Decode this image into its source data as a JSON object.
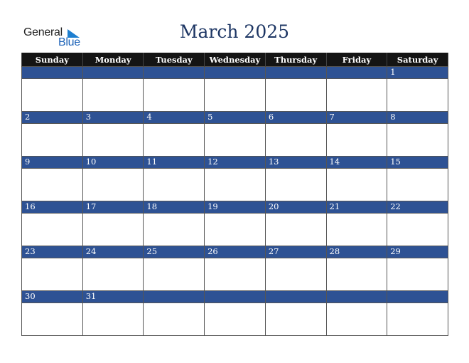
{
  "logo": {
    "line1": "General",
    "line2": "Blue"
  },
  "title": "March 2025",
  "weekdays": [
    "Sunday",
    "Monday",
    "Tuesday",
    "Wednesday",
    "Thursday",
    "Friday",
    "Saturday"
  ],
  "weeks": [
    [
      "",
      "",
      "",
      "",
      "",
      "",
      "1"
    ],
    [
      "2",
      "3",
      "4",
      "5",
      "6",
      "7",
      "8"
    ],
    [
      "9",
      "10",
      "11",
      "12",
      "13",
      "14",
      "15"
    ],
    [
      "16",
      "17",
      "18",
      "19",
      "20",
      "21",
      "22"
    ],
    [
      "23",
      "24",
      "25",
      "26",
      "27",
      "28",
      "29"
    ],
    [
      "30",
      "31",
      "",
      "",
      "",
      "",
      ""
    ]
  ],
  "colors": {
    "header_bg": "#141414",
    "date_bar": "#2e5294",
    "title": "#1c3563",
    "logo_blue": "#1e63b8"
  }
}
